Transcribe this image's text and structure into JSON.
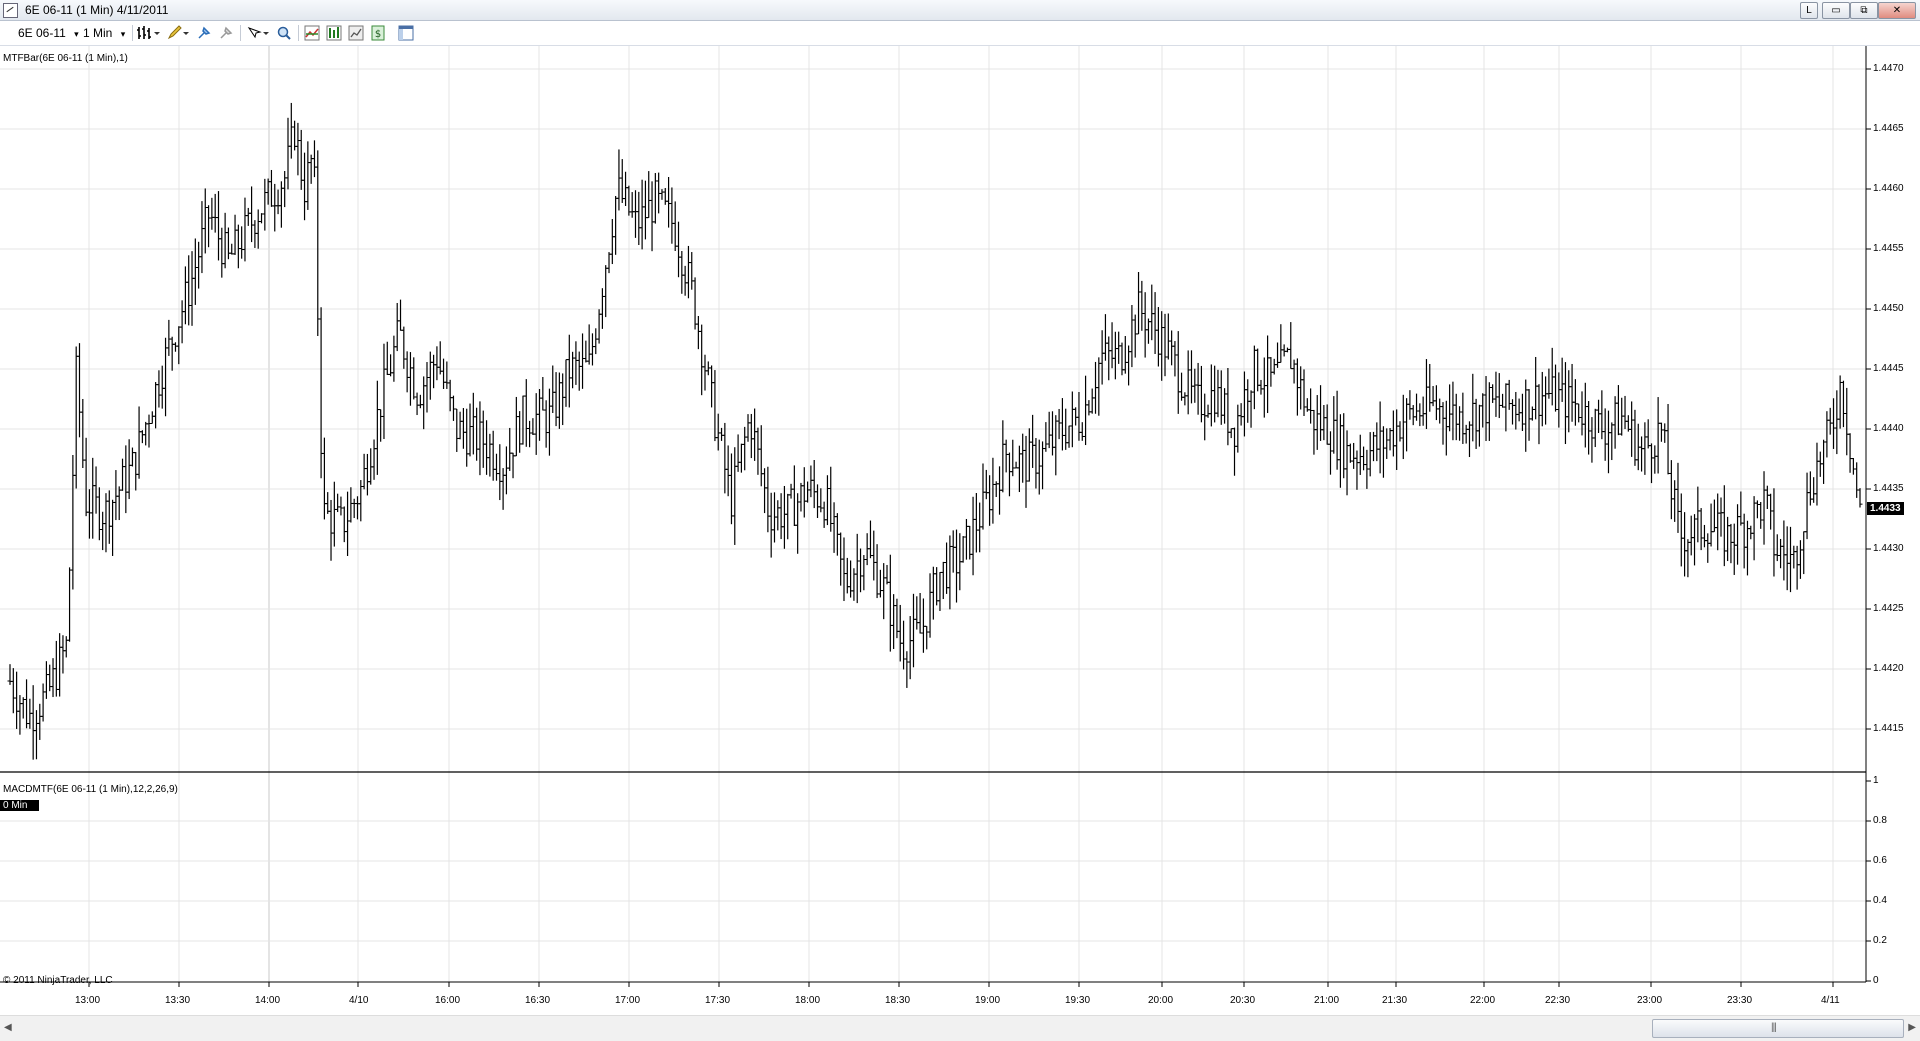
{
  "window": {
    "title": "6E 06-11 (1 Min)  4/11/2011",
    "buttons": {
      "link": "L",
      "minimize": "▭",
      "restore": "⧉",
      "close": "✕"
    }
  },
  "toolbar": {
    "instrument": "6E 06-11",
    "interval": "1 Min",
    "dropdown_caret": "▾",
    "icons": [
      "bar-style-icon",
      "pencil-drawing-icon",
      "pin-icon",
      "pin-disabled-icon",
      "crosshair-cursor-icon",
      "zoom-icon",
      "indicators-icon",
      "strategies-icon",
      "chart-properties-icon",
      "data-box-icon",
      "panel-icon"
    ]
  },
  "price_panel": {
    "label": "MTFBar(6E 06-11 (1 Min),1)",
    "current_price": "1.4433",
    "y_ticks": [
      "1.4470",
      "1.4465",
      "1.4460",
      "1.4455",
      "1.4450",
      "1.4445",
      "1.4440",
      "1.4435",
      "1.4430",
      "1.4425",
      "1.4420",
      "1.4415"
    ]
  },
  "indicator_panel": {
    "label": "MACDMTF(6E 06-11 (1 Min),12,2,26,9)",
    "badge": "0 Min",
    "y_ticks": [
      "1",
      "0.8",
      "0.6",
      "0.4",
      "0.2",
      "0"
    ]
  },
  "x_ticks": [
    "13:00",
    "13:30",
    "14:00",
    "4/10",
    "16:00",
    "16:30",
    "17:00",
    "17:30",
    "18:00",
    "18:30",
    "19:00",
    "19:30",
    "20:00",
    "20:30",
    "21:00",
    "21:30",
    "22:00",
    "22:30",
    "23:00",
    "23:30",
    "4/11"
  ],
  "copyright": "© 2011 NinjaTrader, LLC",
  "scrollbar": {
    "left_arrow": "◀",
    "right_arrow": "▶",
    "grip": "|||"
  },
  "colors": {
    "bars": "#000000",
    "grid": "#e4e4e4",
    "price_marker_bg": "#000000",
    "price_marker_text": "#ffffff"
  },
  "chart_data": {
    "type": "ohlc",
    "title": "MTFBar(6E 06-11 (1 Min),1)",
    "ylim": [
      1.4412,
      1.4472
    ],
    "grid": true,
    "x_labels": [
      "13:00",
      "13:30",
      "14:00",
      "4/10",
      "16:00",
      "16:30",
      "17:00",
      "17:30",
      "18:00",
      "18:30",
      "19:00",
      "19:30",
      "20:00",
      "20:30",
      "21:00",
      "21:30",
      "22:00",
      "22:30",
      "23:00",
      "23:30",
      "4/11"
    ],
    "close_path": [
      [
        0,
        1.4419
      ],
      [
        2,
        1.4416
      ],
      [
        4,
        1.4418
      ],
      [
        6,
        1.4422
      ],
      [
        7,
        1.4445
      ],
      [
        8,
        1.4434
      ],
      [
        10,
        1.4433
      ],
      [
        13,
        1.4437
      ],
      [
        16,
        1.4445
      ],
      [
        19,
        1.4452
      ],
      [
        21,
        1.4458
      ],
      [
        23,
        1.4454
      ],
      [
        26,
        1.4458
      ],
      [
        29,
        1.4461
      ],
      [
        30,
        1.4465
      ],
      [
        31,
        1.446
      ],
      [
        32,
        1.4463
      ],
      [
        33,
        1.4433
      ],
      [
        35,
        1.4432
      ],
      [
        37,
        1.4435
      ],
      [
        39,
        1.4442
      ],
      [
        41,
        1.4448
      ],
      [
        43,
        1.4443
      ],
      [
        45,
        1.4446
      ],
      [
        47,
        1.444
      ],
      [
        50,
        1.4439
      ],
      [
        52,
        1.4437
      ],
      [
        54,
        1.4441
      ],
      [
        57,
        1.4441
      ],
      [
        59,
        1.4445
      ],
      [
        61,
        1.4445
      ],
      [
        63,
        1.4455
      ],
      [
        64,
        1.446
      ],
      [
        66,
        1.4457
      ],
      [
        68,
        1.4459
      ],
      [
        70,
        1.4457
      ],
      [
        72,
        1.4451
      ],
      [
        74,
        1.4442
      ],
      [
        76,
        1.4434
      ],
      [
        78,
        1.4441
      ],
      [
        80,
        1.4433
      ],
      [
        82,
        1.4433
      ],
      [
        84,
        1.4435
      ],
      [
        86,
        1.4434
      ],
      [
        88,
        1.4427
      ],
      [
        90,
        1.443
      ],
      [
        92,
        1.4427
      ],
      [
        94,
        1.4422
      ],
      [
        96,
        1.4423
      ],
      [
        98,
        1.4428
      ],
      [
        100,
        1.4429
      ],
      [
        103,
        1.4434
      ],
      [
        105,
        1.4438
      ],
      [
        107,
        1.4437
      ],
      [
        109,
        1.4438
      ],
      [
        111,
        1.444
      ],
      [
        113,
        1.4441
      ],
      [
        115,
        1.4446
      ],
      [
        117,
        1.4446
      ],
      [
        119,
        1.445
      ],
      [
        121,
        1.4448
      ],
      [
        123,
        1.4445
      ],
      [
        125,
        1.4442
      ],
      [
        127,
        1.4443
      ],
      [
        129,
        1.444
      ],
      [
        131,
        1.4445
      ],
      [
        133,
        1.4444
      ],
      [
        135,
        1.4446
      ],
      [
        137,
        1.4441
      ],
      [
        139,
        1.444
      ],
      [
        141,
        1.4438
      ],
      [
        143,
        1.4438
      ],
      [
        145,
        1.4439
      ],
      [
        147,
        1.4441
      ],
      [
        150,
        1.4442
      ],
      [
        153,
        1.4441
      ],
      [
        156,
        1.4442
      ],
      [
        159,
        1.4442
      ],
      [
        162,
        1.4443
      ],
      [
        165,
        1.4442
      ],
      [
        168,
        1.444
      ],
      [
        170,
        1.4441
      ],
      [
        172,
        1.4438
      ],
      [
        174,
        1.444
      ],
      [
        176,
        1.4431
      ],
      [
        179,
        1.4432
      ],
      [
        181,
        1.4431
      ],
      [
        183,
        1.4432
      ],
      [
        185,
        1.4434
      ],
      [
        186,
        1.443
      ],
      [
        188,
        1.4429
      ],
      [
        190,
        1.4436
      ],
      [
        192,
        1.444
      ],
      [
        193,
        1.4444
      ],
      [
        195,
        1.4433
      ]
    ],
    "max_index": 195
  }
}
